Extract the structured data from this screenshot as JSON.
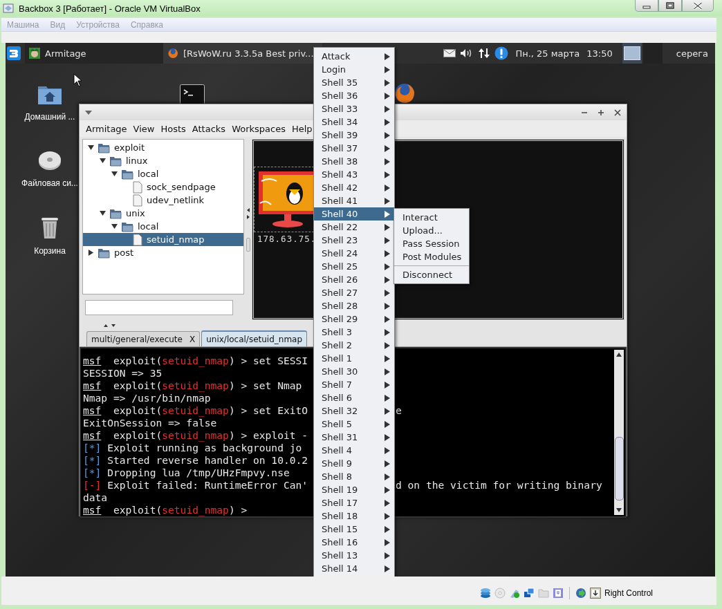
{
  "host_window": {
    "title": "Backbox 3 [Работает] - Oracle VM VirtualBox",
    "menu": [
      {
        "label": "Машина",
        "disabled": true
      },
      {
        "label": "Вид",
        "disabled": true
      },
      {
        "label": "Устройства",
        "disabled": true
      },
      {
        "label": "Справка",
        "disabled": true
      }
    ],
    "status_bar": {
      "host_key": "Right Control"
    }
  },
  "guest_panel": {
    "tasks": [
      {
        "label": "Armitage",
        "kind": "armitage"
      },
      {
        "label": "[RsWoW.ru 3.3.5a Best priv...",
        "kind": "browser"
      }
    ],
    "date": "Пн., 25 марта",
    "time": "13:50",
    "workspaces": [
      {
        "selected": true
      },
      {
        "selected": false
      }
    ],
    "user": "серега"
  },
  "desktop_icons": [
    {
      "label": "Домашний ...",
      "kind": "home"
    },
    {
      "label": "Файловая си...",
      "kind": "drive"
    },
    {
      "label": "Корзина",
      "kind": "trash"
    }
  ],
  "armitage": {
    "menu": [
      "Armitage",
      "View",
      "Hosts",
      "Attacks",
      "Workspaces",
      "Help"
    ],
    "module_tree": [
      {
        "label": "exploit",
        "kind": "folder",
        "expanded": true,
        "selected": false,
        "children": [
          {
            "label": "linux",
            "kind": "folder",
            "expanded": true,
            "selected": false,
            "children": [
              {
                "label": "local",
                "kind": "folder",
                "expanded": true,
                "selected": false,
                "children": [
                  {
                    "label": "sock_sendpage",
                    "kind": "file",
                    "selected": false
                  },
                  {
                    "label": "udev_netlink",
                    "kind": "file",
                    "selected": false
                  }
                ]
              }
            ]
          },
          {
            "label": "unix",
            "kind": "folder",
            "expanded": true,
            "selected": false,
            "children": [
              {
                "label": "local",
                "kind": "folder",
                "expanded": true,
                "selected": false,
                "children": [
                  {
                    "label": "setuid_nmap",
                    "kind": "file",
                    "selected": true
                  }
                ]
              }
            ]
          }
        ]
      },
      {
        "label": "post",
        "kind": "folder",
        "expanded": false,
        "selected": false
      }
    ],
    "hosts": [
      {
        "address": "178.63.75.",
        "selected": true
      }
    ],
    "tabs": [
      {
        "label": "multi/general/execute",
        "close": "X",
        "selected": false
      },
      {
        "label": "unix/local/setuid_nmap",
        "selected": true
      }
    ],
    "console": [
      {
        "kind": "prompt",
        "prompt": "msf",
        "text": "  exploit(",
        "module": "setuid_nmap",
        "rest": ") > set SESSI"
      },
      {
        "kind": "output",
        "text": "SESSION => 35"
      },
      {
        "kind": "prompt",
        "prompt": "msf",
        "text": "  exploit(",
        "module": "setuid_nmap",
        "rest": ") > set Nmap"
      },
      {
        "kind": "output",
        "text": "Nmap => /usr/bin/nmap"
      },
      {
        "kind": "prompt",
        "prompt": "msf",
        "text": "  exploit(",
        "module": "setuid_nmap",
        "rest": ") > set ExitO",
        "after": "e"
      },
      {
        "kind": "output",
        "text": "ExitOnSession => false"
      },
      {
        "kind": "prompt",
        "prompt": "msf",
        "text": "  exploit(",
        "module": "setuid_nmap",
        "rest": ") > exploit -"
      },
      {
        "kind": "status",
        "tag": "[*]",
        "text": "Exploit running as background jo"
      },
      {
        "kind": "status",
        "tag": "[*]",
        "text": "Started reverse handler on 10.0.2"
      },
      {
        "kind": "status",
        "tag": "[*]",
        "text": "Dropping lua /tmp/UHzFmpvy.nse"
      },
      {
        "kind": "error",
        "tag": "[-]",
        "text": "Exploit failed: RuntimeError Can'",
        "after": "d on the victim for writing binary"
      },
      {
        "kind": "output",
        "text": "data"
      },
      {
        "kind": "prompt",
        "prompt": "msf",
        "text": "  exploit(",
        "module": "setuid_nmap",
        "rest": ") > "
      }
    ]
  },
  "context_menu": {
    "items": [
      {
        "label": "Attack",
        "selected": false
      },
      {
        "label": "Login",
        "selected": false
      },
      {
        "label": "Shell 35",
        "selected": false
      },
      {
        "label": "Shell 36",
        "selected": false
      },
      {
        "label": "Shell 33",
        "selected": false
      },
      {
        "label": "Shell 34",
        "selected": false
      },
      {
        "label": "Shell 39",
        "selected": false
      },
      {
        "label": "Shell 37",
        "selected": false
      },
      {
        "label": "Shell 38",
        "selected": false
      },
      {
        "label": "Shell 43",
        "selected": false
      },
      {
        "label": "Shell 42",
        "selected": false
      },
      {
        "label": "Shell 41",
        "selected": false
      },
      {
        "label": "Shell 40",
        "selected": true
      },
      {
        "label": "Shell 22",
        "selected": false
      },
      {
        "label": "Shell 23",
        "selected": false
      },
      {
        "label": "Shell 24",
        "selected": false
      },
      {
        "label": "Shell 25",
        "selected": false
      },
      {
        "label": "Shell 26",
        "selected": false
      },
      {
        "label": "Shell 27",
        "selected": false
      },
      {
        "label": "Shell 28",
        "selected": false
      },
      {
        "label": "Shell 29",
        "selected": false
      },
      {
        "label": "Shell 3",
        "selected": false
      },
      {
        "label": "Shell 2",
        "selected": false
      },
      {
        "label": "Shell 1",
        "selected": false
      },
      {
        "label": "Shell 30",
        "selected": false
      },
      {
        "label": "Shell 7",
        "selected": false
      },
      {
        "label": "Shell 6",
        "selected": false
      },
      {
        "label": "Shell 32",
        "selected": false
      },
      {
        "label": "Shell 5",
        "selected": false
      },
      {
        "label": "Shell 31",
        "selected": false
      },
      {
        "label": "Shell 4",
        "selected": false
      },
      {
        "label": "Shell 9",
        "selected": false
      },
      {
        "label": "Shell 8",
        "selected": false
      },
      {
        "label": "Shell 19",
        "selected": false
      },
      {
        "label": "Shell 17",
        "selected": false
      },
      {
        "label": "Shell 18",
        "selected": false
      },
      {
        "label": "Shell 15",
        "selected": false
      },
      {
        "label": "Shell 16",
        "selected": false
      },
      {
        "label": "Shell 13",
        "selected": false
      },
      {
        "label": "Shell 14",
        "selected": false
      }
    ],
    "submenu": [
      {
        "kind": "item",
        "label": "Interact"
      },
      {
        "kind": "item",
        "label": "Upload..."
      },
      {
        "kind": "item",
        "label": "Pass Session"
      },
      {
        "kind": "item",
        "label": "Post Modules"
      },
      {
        "kind": "separator"
      },
      {
        "kind": "item",
        "label": "Disconnect"
      }
    ]
  }
}
